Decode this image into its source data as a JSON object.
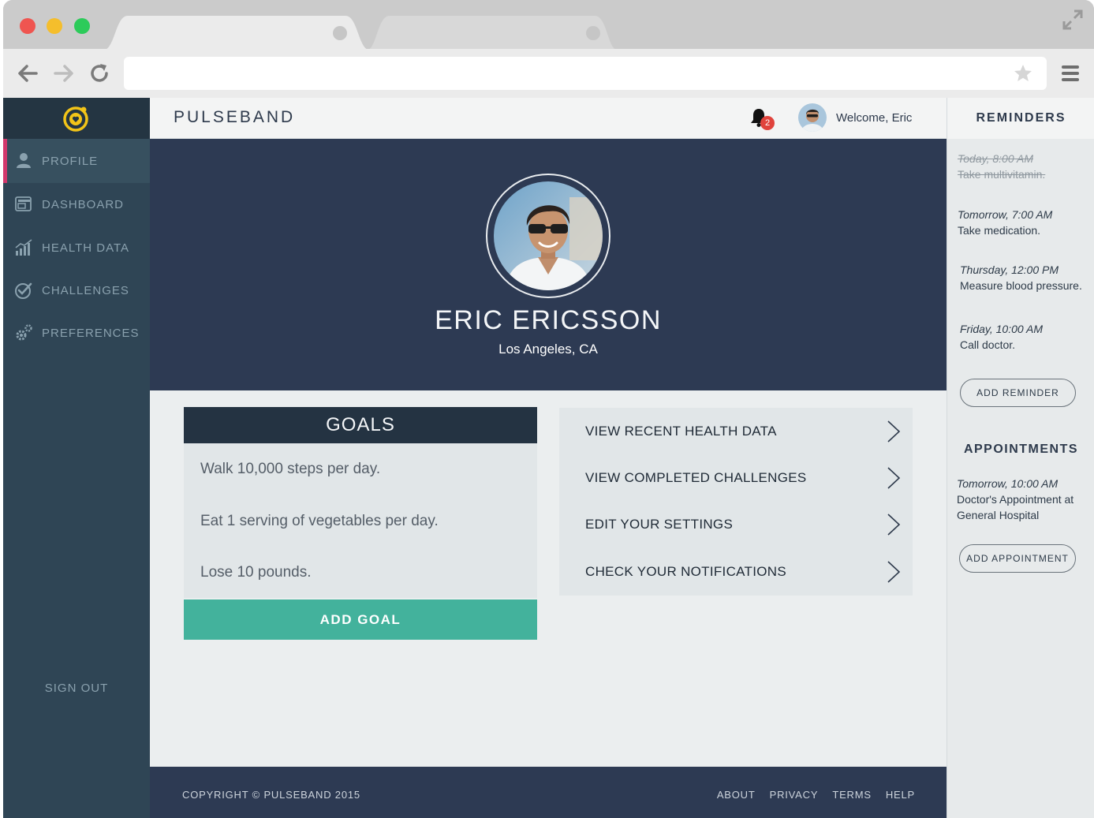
{
  "browser": {
    "url": "",
    "icons": [
      "arrow-left-icon",
      "arrow-right-icon",
      "reload-icon",
      "star-icon",
      "hamburger-menu-icon",
      "expand-icon"
    ]
  },
  "app": {
    "brand": "PULSEBAND",
    "colors": {
      "sidebar": "#2f4555",
      "hero": "#2d3a53",
      "accent_teal": "#43b29c",
      "active_marker": "#d3386c",
      "logo": "#f2c418",
      "badge": "#e0433c"
    }
  },
  "sidebar": {
    "items": [
      {
        "label": "PROFILE",
        "icon": "user-icon",
        "active": true
      },
      {
        "label": "DASHBOARD",
        "icon": "dashboard-icon",
        "active": false
      },
      {
        "label": "HEALTH DATA",
        "icon": "bar-chart-icon",
        "active": false
      },
      {
        "label": "CHALLENGES",
        "icon": "check-circle-icon",
        "active": false
      },
      {
        "label": "PREFERENCES",
        "icon": "gears-icon",
        "active": false
      }
    ],
    "sign_out": "SIGN OUT"
  },
  "topbar": {
    "notification_count": "2",
    "welcome": "Welcome, Eric"
  },
  "profile": {
    "name": "ERIC ERICSSON",
    "location": "Los Angeles, CA"
  },
  "goals": {
    "title": "GOALS",
    "items": [
      "Walk 10,000 steps per day.",
      "Eat 1 serving of vegetables per day.",
      "Lose 10 pounds."
    ],
    "add_label": "ADD GOAL"
  },
  "quick_links": [
    "VIEW RECENT HEALTH DATA",
    "VIEW COMPLETED CHALLENGES",
    "EDIT YOUR SETTINGS",
    "CHECK YOUR NOTIFICATIONS"
  ],
  "footer": {
    "copyright": "COPYRIGHT © PULSEBAND 2015",
    "links": [
      "ABOUT",
      "PRIVACY",
      "TERMS",
      "HELP"
    ]
  },
  "reminders": {
    "title": "REMINDERS",
    "items": [
      {
        "time": "Today, 8:00 AM",
        "text": "Take multivitamin.",
        "done": true
      },
      {
        "time": "Tomorrow, 7:00 AM",
        "text": "Take medication.",
        "done": false
      },
      {
        "time": "Thursday, 12:00 PM",
        "text": "Measure blood pressure.",
        "done": false
      },
      {
        "time": "Friday, 10:00 AM",
        "text": "Call doctor.",
        "done": false
      }
    ],
    "add_label": "ADD REMINDER"
  },
  "appointments": {
    "title": "APPOINTMENTS",
    "items": [
      {
        "time": "Tomorrow, 10:00 AM",
        "text": "Doctor's Appointment at General Hospital"
      }
    ],
    "add_label": "ADD APPOINTMENT"
  }
}
